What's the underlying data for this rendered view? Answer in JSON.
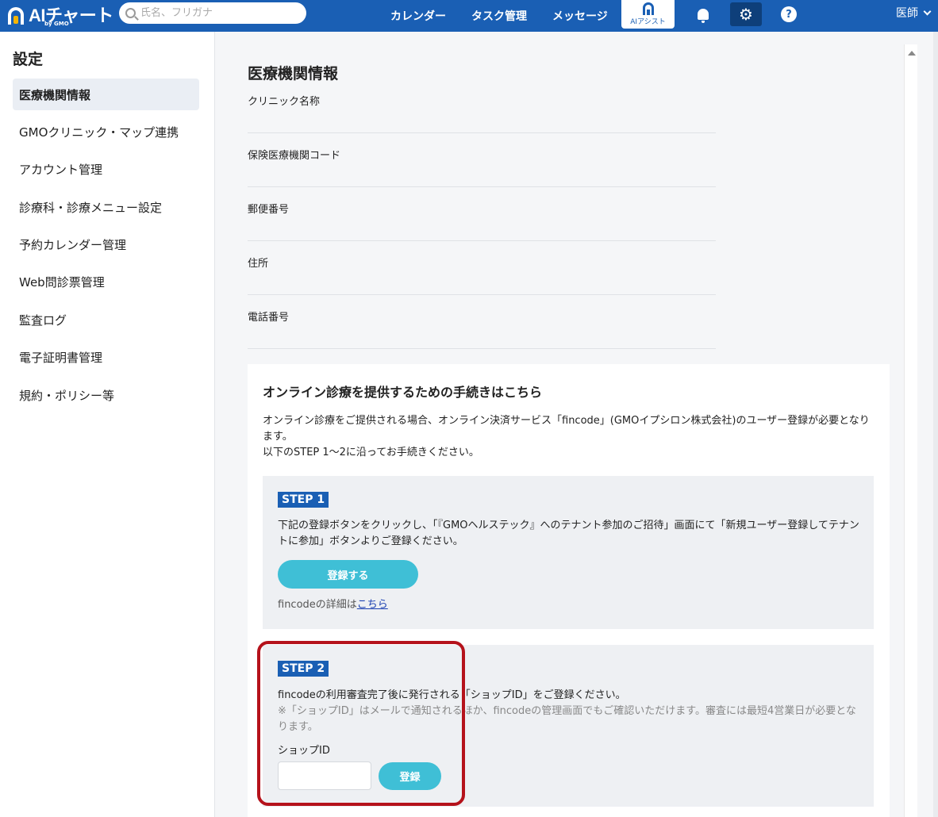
{
  "header": {
    "logo_text": "AIチャート",
    "logo_sub": "by GMO",
    "search_placeholder": "氏名、フリガナ",
    "nav": [
      "カレンダー",
      "タスク管理",
      "メッセージ"
    ],
    "assist_label": "AIアシスト",
    "help_glyph": "?",
    "user_label": "医師",
    "accent_color": "#1a5fb4"
  },
  "sidebar": {
    "title": "設定",
    "items": [
      {
        "label": "医療機関情報",
        "active": true
      },
      {
        "label": "GMOクリニック・マップ連携"
      },
      {
        "label": "アカウント管理"
      },
      {
        "label": "診療科・診療メニュー設定"
      },
      {
        "label": "予約カレンダー管理"
      },
      {
        "label": "Web問診票管理"
      },
      {
        "label": "監査ログ"
      },
      {
        "label": "電子証明書管理"
      },
      {
        "label": "規約・ポリシー等"
      }
    ]
  },
  "main": {
    "title": "医療機関情報",
    "fields": [
      "クリニック名称",
      "保険医療機関コード",
      "郵便番号",
      "住所",
      "電話番号"
    ],
    "online": {
      "title": "オンライン診療を提供するための手続きはこちら",
      "desc_1": "オンライン診療をご提供される場合、オンライン決済サービス「fincode」(GMOイプシロン株式会社)のユーザー登録が必要となります。",
      "desc_2": "以下のSTEP 1〜2に沿ってお手続きください。",
      "step1": {
        "badge": "STEP 1",
        "text": "下記の登録ボタンをクリックし、「『GMOヘルステック』へのテナント参加のご招待」画面にて「新規ユーザー登録してテナントに参加」ボタンよりご登録ください。",
        "button": "登録する",
        "link_prefix": "fincodeの詳細は",
        "link_text": "こちら"
      },
      "step2": {
        "badge": "STEP 2",
        "text": "fincodeの利用審査完了後に発行される「ショップID」をご登録ください。",
        "note": "※「ショップID」はメールで通知されるほか、fincodeの管理画面でもご確認いただけます。審査には最短4営業日が必要となります。",
        "shop_label": "ショップID",
        "shop_value": "",
        "button": "登録"
      }
    }
  },
  "colors": {
    "button_cyan": "#3fbfd6",
    "highlight_red": "#b5121b"
  }
}
